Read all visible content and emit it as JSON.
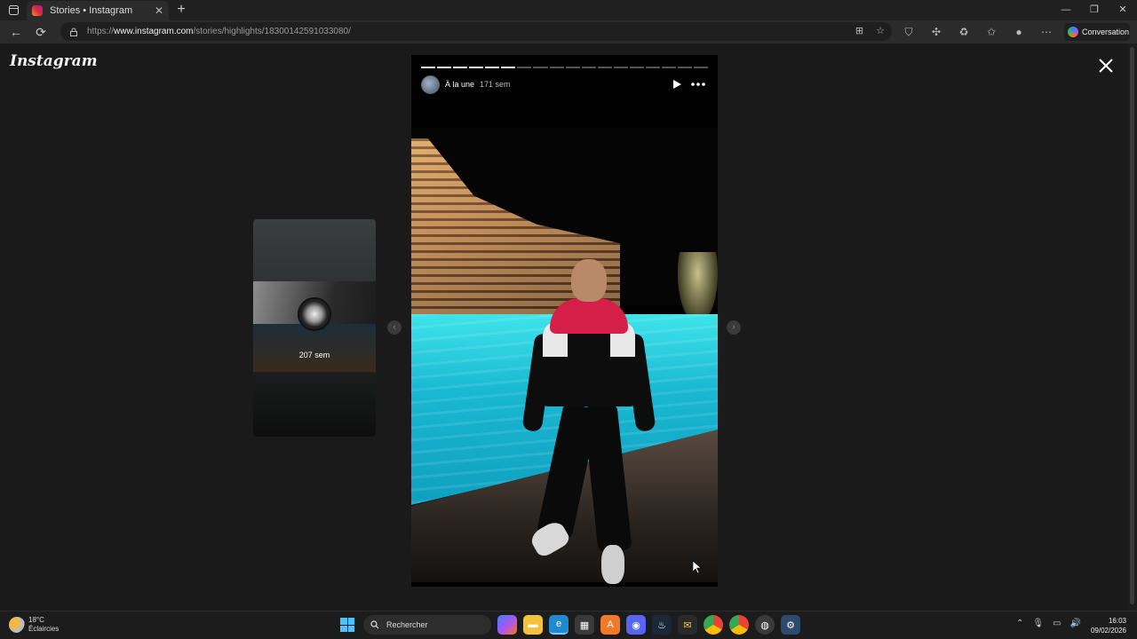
{
  "browser": {
    "tab_title": "Stories • Instagram",
    "url_prefix": "https://",
    "url_host": "www.instagram.com",
    "url_path": "/stories/highlights/18300142591033080/",
    "conversation_label": "Conversation"
  },
  "instagram": {
    "logo_text": "Instagram",
    "preview": {
      "age_label": "207 sem"
    },
    "story": {
      "highlight_name": "À la une",
      "age_label": "171 sem",
      "progress": {
        "segments_total": 18,
        "segments_done": 6
      }
    }
  },
  "taskbar": {
    "weather_temp": "18°C",
    "weather_desc": "Éclaircies",
    "search_placeholder": "Rechercher",
    "time": "16:03",
    "date": "09/02/2026"
  }
}
